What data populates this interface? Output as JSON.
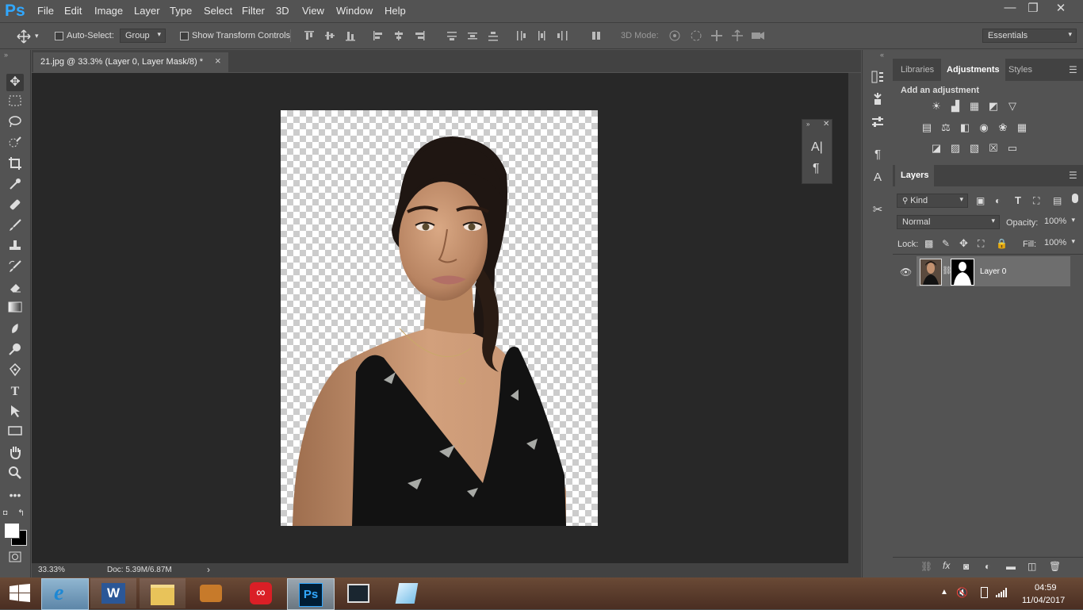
{
  "app": {
    "logo": "Ps"
  },
  "menu": [
    "File",
    "Edit",
    "Image",
    "Layer",
    "Type",
    "Select",
    "Filter",
    "3D",
    "View",
    "Window",
    "Help"
  ],
  "window_controls": {
    "minimize": "—",
    "restore": "❐",
    "close": "✕"
  },
  "options": {
    "auto_select_label": "Auto-Select:",
    "auto_select_value": "Group",
    "show_transform_label": "Show Transform Controls",
    "mode_3d_label": "3D Mode:",
    "workspace_value": "Essentials"
  },
  "document": {
    "tab_title": "21.jpg @ 33.3% (Layer 0, Layer Mask/8) *",
    "close": "×"
  },
  "status": {
    "zoom": "33.33%",
    "doc": "Doc: 5.39M/6.87M",
    "arrow": "›"
  },
  "panels": {
    "top_tabs": [
      "Libraries",
      "Adjustments",
      "Styles"
    ],
    "active_top_tab": "Adjustments",
    "adjustments_title": "Add an adjustment",
    "layers_tab": "Layers",
    "kind_value": "Kind",
    "blend_mode": "Normal",
    "opacity_label": "Opacity:",
    "opacity_value": "100%",
    "lock_label": "Lock:",
    "fill_label": "Fill:",
    "fill_value": "100%",
    "layers": [
      {
        "name": "Layer 0",
        "visible": true
      }
    ]
  },
  "float_panel": {
    "char_glyph": "A|",
    "para_glyph": "¶"
  },
  "taskbar": {
    "time": "04:59",
    "date": "11/04/2017",
    "apps": [
      "start-button",
      "ie-icon",
      "word-icon",
      "file-explorer-icon",
      "media-player-icon",
      "creative-cloud-icon",
      "photoshop-taskbar-icon",
      "film-icon",
      "notes-icon"
    ]
  },
  "colors": {
    "accent": "#31a8ff",
    "panel": "#535353",
    "workspace": "#282828"
  }
}
